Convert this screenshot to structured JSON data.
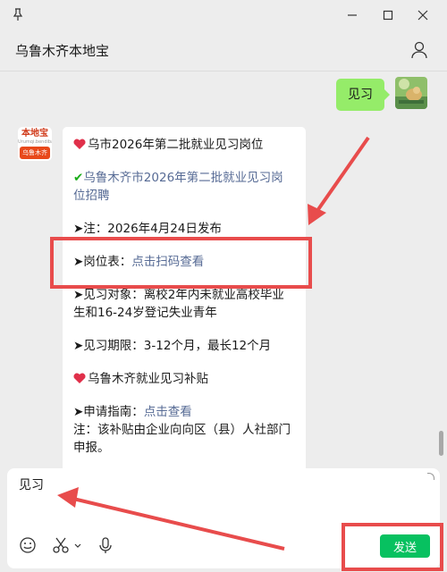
{
  "chat": {
    "title": "乌鲁木齐本地宝"
  },
  "outgoing_message": {
    "text": "见习"
  },
  "bot_avatar": {
    "logo_top": "本地宝",
    "logo_url": "Urumqi.bendibao.com",
    "logo_bottom": "乌鲁木齐"
  },
  "reply": {
    "title": "乌市2026年第二批就业见习岗位",
    "link_title": "乌鲁木齐市2026年第二批就业见习岗位招聘",
    "note_prefix": "➤注：2026年4月24日发布",
    "positions_label": "➤岗位表：",
    "positions_link": "点击扫码查看",
    "target": "➤见习对象：离校2年内未就业高校毕业生和16-24岁登记失业青年",
    "period": "➤见习期限：3-12个月，最长12个月",
    "subsidy_title": "乌鲁木齐就业见习补贴",
    "guide_label": "➤申请指南：",
    "guide_link": "点击查看",
    "guide_note": "注：该补贴由企业向向区（县）人社部门申报。"
  },
  "input": {
    "value": "见习"
  },
  "toolbar": {
    "send_label": "发送"
  },
  "colors": {
    "accent_green": "#07c160",
    "bubble_green": "#95ec69",
    "link_blue": "#576b95",
    "annotation_red": "#e84c4c"
  }
}
